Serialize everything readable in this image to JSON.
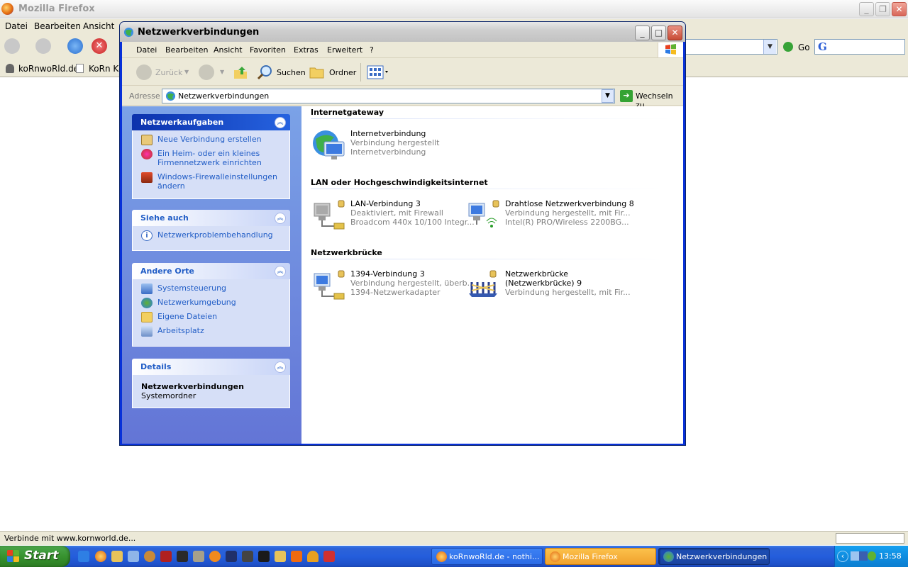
{
  "firefox": {
    "title": "Mozilla Firefox",
    "menu": [
      "Datei",
      "Bearbeiten",
      "Ansicht"
    ],
    "go_label": "Go",
    "bookmarks": [
      "koRnwoRld.de",
      "KoRn Kar"
    ],
    "status_text": "Verbinde mit www.kornworld.de..."
  },
  "explorer": {
    "title": "Netzwerkverbindungen",
    "menu": [
      "Datei",
      "Bearbeiten",
      "Ansicht",
      "Favoriten",
      "Extras",
      "Erweitert",
      "?"
    ],
    "toolbar": {
      "back": "Zurück",
      "search": "Suchen",
      "folders": "Ordner"
    },
    "address": {
      "label": "Adresse",
      "value": "Netzwerkverbindungen",
      "go_label": "Wechseln zu"
    },
    "taskpane": {
      "network_tasks": {
        "title": "Netzwerkaufgaben",
        "items": [
          "Neue Verbindung erstellen",
          "Ein Heim- oder ein kleines Firmennetzwerk einrichten",
          "Windows-Firewalleinstellungen ändern"
        ]
      },
      "see_also": {
        "title": "Siehe auch",
        "items": [
          "Netzwerkproblembehandlung"
        ]
      },
      "other_places": {
        "title": "Andere Orte",
        "items": [
          "Systemsteuerung",
          "Netzwerkumgebung",
          "Eigene Dateien",
          "Arbeitsplatz"
        ]
      },
      "details": {
        "title": "Details",
        "name": "Netzwerkverbindungen",
        "type": "Systemordner"
      }
    },
    "sections": [
      {
        "title": "Internetgateway",
        "items": [
          {
            "name": "Internetverbindung",
            "status": "Verbindung hergestellt",
            "device": "Internetverbindung",
            "icon": "internet-gateway-icon"
          }
        ]
      },
      {
        "title": "LAN oder Hochgeschwindigkeitsinternet",
        "items": [
          {
            "name": "LAN-Verbindung 3",
            "status": "Deaktiviert, mit Firewall",
            "device": "Broadcom 440x 10/100 Integr...",
            "icon": "lan-connection-icon"
          },
          {
            "name": "Drahtlose Netzwerkverbindung 8",
            "status": "Verbindung hergestellt, mit Fir...",
            "device": "Intel(R) PRO/Wireless 2200BG...",
            "icon": "wireless-connection-icon"
          }
        ]
      },
      {
        "title": "Netzwerkbrücke",
        "items": [
          {
            "name": "1394-Verbindung 3",
            "status": "Verbindung hergestellt, überb...",
            "device": "1394-Netzwerkadapter",
            "icon": "lan-connection-icon"
          },
          {
            "name": "Netzwerkbrücke",
            "status": "(Netzwerkbrücke) 9",
            "device": "Verbindung hergestellt, mit Fir...",
            "icon": "network-bridge-icon"
          }
        ]
      }
    ]
  },
  "taskbar": {
    "start_label": "Start",
    "tasks": [
      "koRnwoRld.de - nothi...",
      "Mozilla Firefox",
      "Netzwerkverbindungen"
    ],
    "clock": "13:58"
  }
}
